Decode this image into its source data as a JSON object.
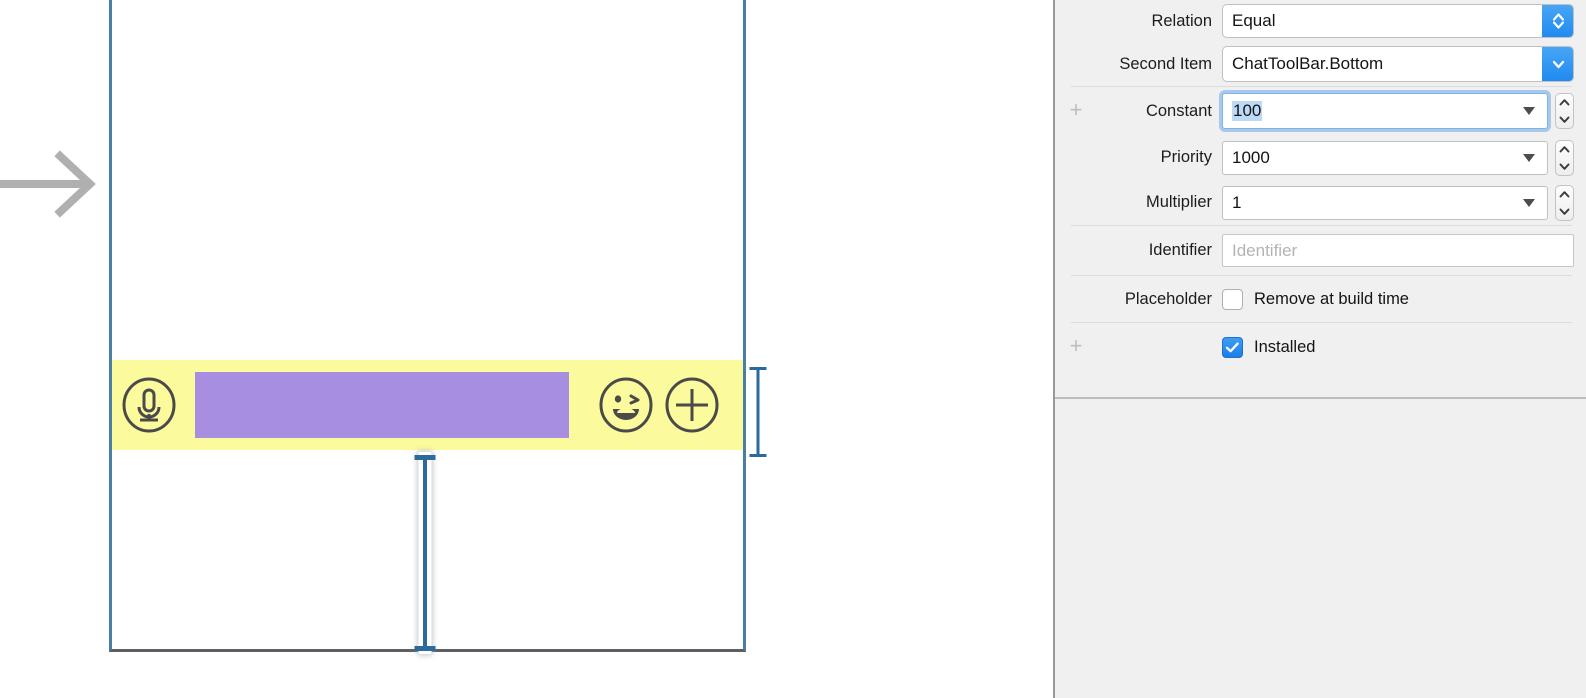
{
  "canvas": {
    "segue_arrow_icon": "arrow-right-icon",
    "toolbar": {
      "name": "ChatToolBar",
      "mic_icon": "microphone-circle-icon",
      "text_field_label": "",
      "emoji_icon": "smiley-wink-circle-icon",
      "plus_icon": "plus-circle-icon",
      "highlight_color": "#fbfa9c",
      "textfield_color": "#a78ee0"
    },
    "constraints": {
      "right_indicator": "height-constraint-indicator",
      "bottom_indicator": "bottom-spacing-constraint-indicator",
      "indicator_color": "#2b6a9b"
    },
    "device_border_color": "#4a7fa5"
  },
  "inspector": {
    "rows": [
      {
        "label": "Relation",
        "value": "Equal",
        "control": "popup",
        "endcap_icon": "chevron-up-down-icon"
      },
      {
        "label": "Second Item",
        "value": "ChatToolBar.Bottom",
        "control": "popup",
        "endcap_icon": "chevron-down-icon"
      },
      {
        "label": "Constant",
        "value": "100",
        "control": "combo",
        "focused": true,
        "has_stepper": true,
        "gutter": "+"
      },
      {
        "label": "Priority",
        "value": "1000",
        "control": "combo",
        "focused": false,
        "has_stepper": true,
        "gutter": ""
      },
      {
        "label": "Multiplier",
        "value": "1",
        "control": "combo",
        "focused": false,
        "has_stepper": true,
        "gutter": ""
      },
      {
        "label": "Identifier",
        "value": "",
        "placeholder": "Identifier",
        "control": "textfield",
        "gutter": ""
      }
    ],
    "placeholder_row": {
      "label": "Placeholder",
      "checkbox_label": "Remove at build time",
      "checked": false,
      "gutter": ""
    },
    "installed_row": {
      "label": "",
      "checkbox_label": "Installed",
      "checked": true,
      "gutter": "+",
      "check_icon": "checkmark-icon"
    },
    "accent_color": "#1f8af0",
    "selection_color": "#bcd9f5"
  }
}
